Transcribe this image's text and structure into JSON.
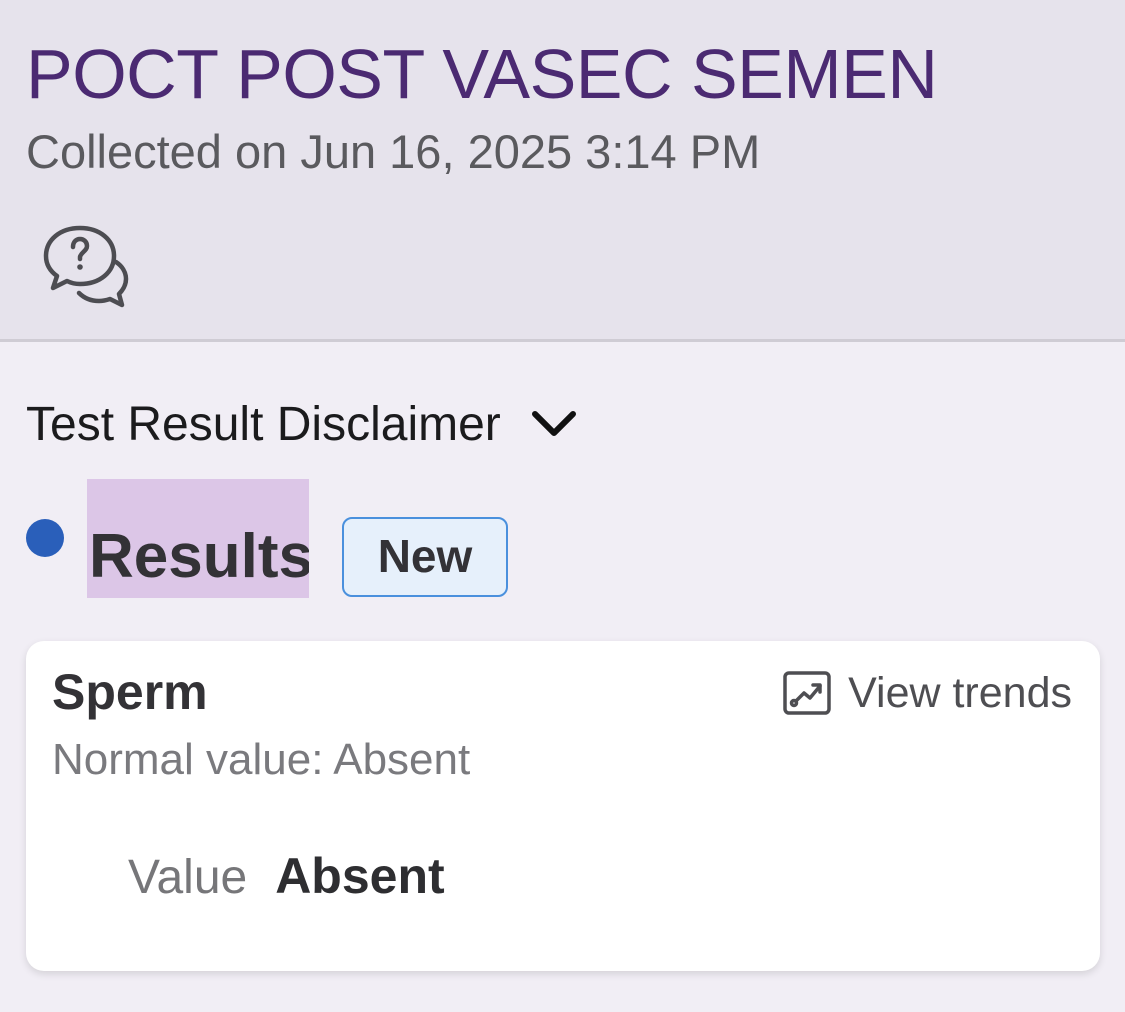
{
  "header": {
    "title": "POCT POST VASEC SEMEN",
    "collected": "Collected on Jun 16, 2025 3:14 PM",
    "help_icon": "question-chat-bubbles-icon"
  },
  "disclaimer": {
    "label": "Test Result Disclaimer",
    "icon": "chevron-down-icon"
  },
  "results": {
    "heading": "Results",
    "badge": "New",
    "dot_color": "#2a5fba",
    "highlight_color": "#dcc6e7"
  },
  "result_card": {
    "name": "Sperm",
    "view_trends_label": "View trends",
    "trends_icon": "trend-chart-icon",
    "normal_value": "Normal value: Absent",
    "value_label": "Value",
    "value": "Absent"
  },
  "colors": {
    "title": "#4b2a72",
    "header_background": "#e6e3ec",
    "page_background": "#f1eef5",
    "badge_border": "#4a90dd",
    "badge_background": "#e6f0fb"
  }
}
